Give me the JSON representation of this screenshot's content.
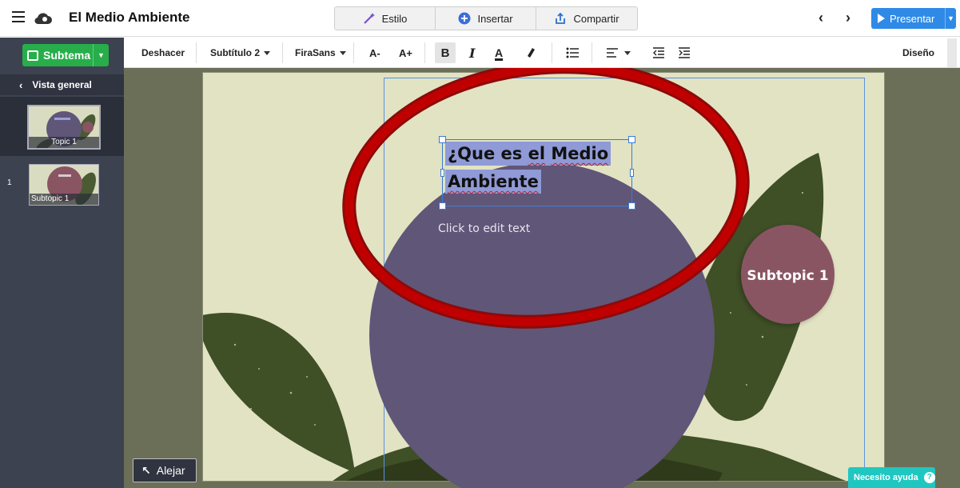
{
  "app": {
    "title": "El Medio Ambiente",
    "tabs": [
      {
        "label": "Estilo",
        "icon": "magic-wand-icon"
      },
      {
        "label": "Insertar",
        "icon": "plus-circle-icon"
      },
      {
        "label": "Compartir",
        "icon": "share-icon"
      }
    ],
    "present_label": "Presentar"
  },
  "sidebar": {
    "add_label": "Subtema",
    "overview_label": "Vista general",
    "topic_caption": "Topic 1",
    "subtopic_number": "1",
    "subtopic_caption": "Subtopic 1"
  },
  "toolbar": {
    "undo_label": "Deshacer",
    "style_select": "Subtítulo 2",
    "font_select": "FiraSans",
    "decrease_font": "A-",
    "increase_font": "A+",
    "bold": "B",
    "italic": "I",
    "font_color": "A",
    "design_label": "Diseño"
  },
  "slide": {
    "title_line1_a": "¿Que es ",
    "title_line1_b": "el",
    "title_line1_c": " ",
    "title_line1_d": "Medio",
    "title_line2": "Ambiente",
    "body_placeholder": "Click to edit text",
    "subtopic_title": "Subtopic 1"
  },
  "canvas": {
    "zoom_out_label": "Alejar",
    "help_label": "Necesito ayuda",
    "help_icon": "?"
  },
  "colors": {
    "accent_blue": "#2e8ae6",
    "accent_green": "#27ae4a",
    "main_circle": "#605678",
    "sub_circle": "#8a5563",
    "annotation_red": "#c00000"
  }
}
